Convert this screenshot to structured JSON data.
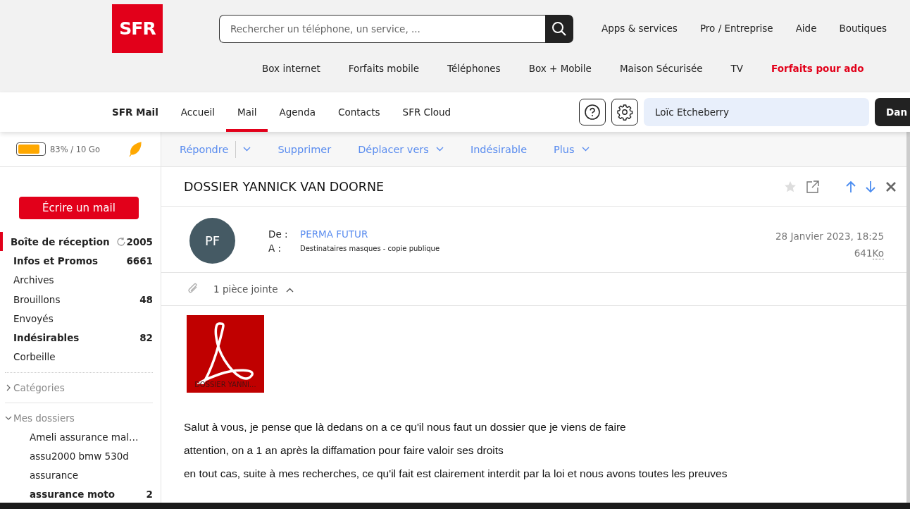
{
  "site_header": {
    "logo": "SFR",
    "search": {
      "placeholder": "Rechercher un téléphone, un service, ..."
    },
    "top_links": [
      "Apps & services",
      "Pro / Entreprise",
      "Aide",
      "Boutiques"
    ],
    "categories": [
      {
        "label": "Box internet",
        "highlight": false
      },
      {
        "label": "Forfaits mobile",
        "highlight": false
      },
      {
        "label": "Téléphones",
        "highlight": false
      },
      {
        "label": "Box + Mobile",
        "highlight": false
      },
      {
        "label": "Maison Sécurisée",
        "highlight": false
      },
      {
        "label": "TV",
        "highlight": false
      },
      {
        "label": "Forfaits pour ado",
        "highlight": true
      }
    ]
  },
  "mail_nav": {
    "brand": "SFR Mail",
    "tabs": [
      {
        "label": "Accueil",
        "selected": false
      },
      {
        "label": "Mail",
        "selected": true
      },
      {
        "label": "Agenda",
        "selected": false
      },
      {
        "label": "Contacts",
        "selected": false
      },
      {
        "label": "SFR Cloud",
        "selected": false
      }
    ],
    "user": "Loïc Etcheberry",
    "button": "Dan"
  },
  "storage": {
    "level": 0.83,
    "text": "83% / 10 Go"
  },
  "compose": "Écrire un mail",
  "folders": [
    {
      "label": "Boîte de réception",
      "count": "2005",
      "unread": true,
      "selected": true,
      "refresh": true
    },
    {
      "label": "Infos et Promos",
      "count": "6661",
      "unread": true,
      "selected": false
    },
    {
      "label": "Archives",
      "unread": false,
      "selected": false
    },
    {
      "label": "Brouillons",
      "count": "48",
      "unread": false,
      "selected": false
    },
    {
      "label": "Envoyés",
      "unread": false,
      "selected": false
    },
    {
      "label": "Indésirables",
      "count": "82",
      "unread": true,
      "selected": false
    },
    {
      "label": "Corbeille",
      "unread": false,
      "selected": false
    }
  ],
  "sections": [
    {
      "label": "Catégories",
      "expanded": false
    },
    {
      "label": "Mes dossiers",
      "expanded": true,
      "children": [
        {
          "label": "Ameli assurance mal…",
          "unread": false
        },
        {
          "label": "assu2000 bmw 530d",
          "unread": false
        },
        {
          "label": "assurance",
          "unread": false
        },
        {
          "label": "assurance moto",
          "count": "2",
          "unread": true
        }
      ]
    }
  ],
  "toolbar": [
    {
      "label": "Répondre",
      "dropdown": true,
      "split": true
    },
    {
      "label": "Supprimer",
      "dropdown": false,
      "split": false
    },
    {
      "label": "Déplacer vers",
      "dropdown": true,
      "split": false
    },
    {
      "label": "Indésirable",
      "dropdown": false,
      "split": false
    },
    {
      "label": "Plus",
      "dropdown": true,
      "split": false
    }
  ],
  "message": {
    "subject": "DOSSIER YANNICK VAN DOORNE",
    "starred": false,
    "avatar": "PF",
    "from_label": "De :",
    "from": "PERMA FUTUR",
    "to_label": "A :",
    "to": "Destinataires masques - copie publique",
    "date": "28 Janvier 2023, 18:25",
    "size": "641",
    "size_unit": "Ko",
    "attachments_label": "1 pièce jointe",
    "attachments_expanded": true,
    "attachments": [
      {
        "name": "DOSSIER YANNI…"
      }
    ],
    "body": [
      "Salut à vous, je pense que là dedans on a ce qu'il nous faut un dossier que je viens de faire",
      "attention, on a 1 an après la diffamation pour faire valoir ses droits",
      "en tout cas, suite à mes recherches, ce qu'il fait est clairement interdit par la loi et nous avons toutes les preuves"
    ]
  }
}
